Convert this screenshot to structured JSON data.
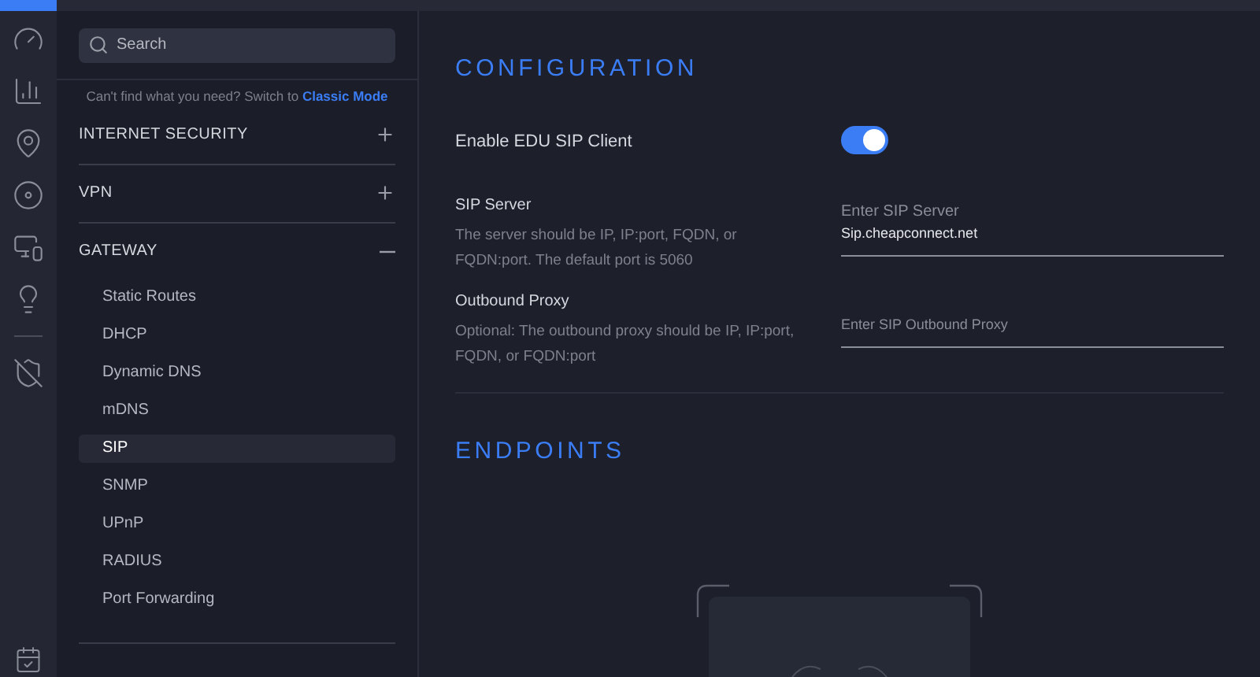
{
  "sidebar": {
    "search": {
      "placeholder": "Search"
    },
    "hint": {
      "text": "Can't find what you need? Switch to",
      "link": "Classic Mode"
    },
    "sections": [
      {
        "title": "INTERNET SECURITY",
        "expanded": false
      },
      {
        "title": "VPN",
        "expanded": false
      },
      {
        "title": "GATEWAY",
        "expanded": true,
        "items": [
          {
            "label": "Static Routes",
            "selected": false
          },
          {
            "label": "DHCP",
            "selected": false
          },
          {
            "label": "Dynamic DNS",
            "selected": false
          },
          {
            "label": "mDNS",
            "selected": false
          },
          {
            "label": "SIP",
            "selected": true
          },
          {
            "label": "SNMP",
            "selected": false
          },
          {
            "label": "UPnP",
            "selected": false
          },
          {
            "label": "RADIUS",
            "selected": false
          },
          {
            "label": "Port Forwarding",
            "selected": false
          }
        ]
      }
    ]
  },
  "configuration": {
    "title": "CONFIGURATION",
    "settings": [
      {
        "kind": "toggle",
        "label": "Enable EDU SIP Client",
        "on": true
      },
      {
        "kind": "field",
        "label": "SIP Server",
        "description": "The server should be IP, IP:port, FQDN, or FQDN:port. The default port is 5060",
        "placeholder": "Enter SIP Server",
        "value": "Sip.cheapconnect.net"
      },
      {
        "kind": "field",
        "label": "Outbound Proxy",
        "description": "Optional: The outbound proxy should be IP, IP:port, FQDN, or FQDN:port",
        "placeholder": "Enter SIP Outbound Proxy"
      }
    ]
  },
  "endpoints": {
    "title": "ENDPOINTS"
  }
}
